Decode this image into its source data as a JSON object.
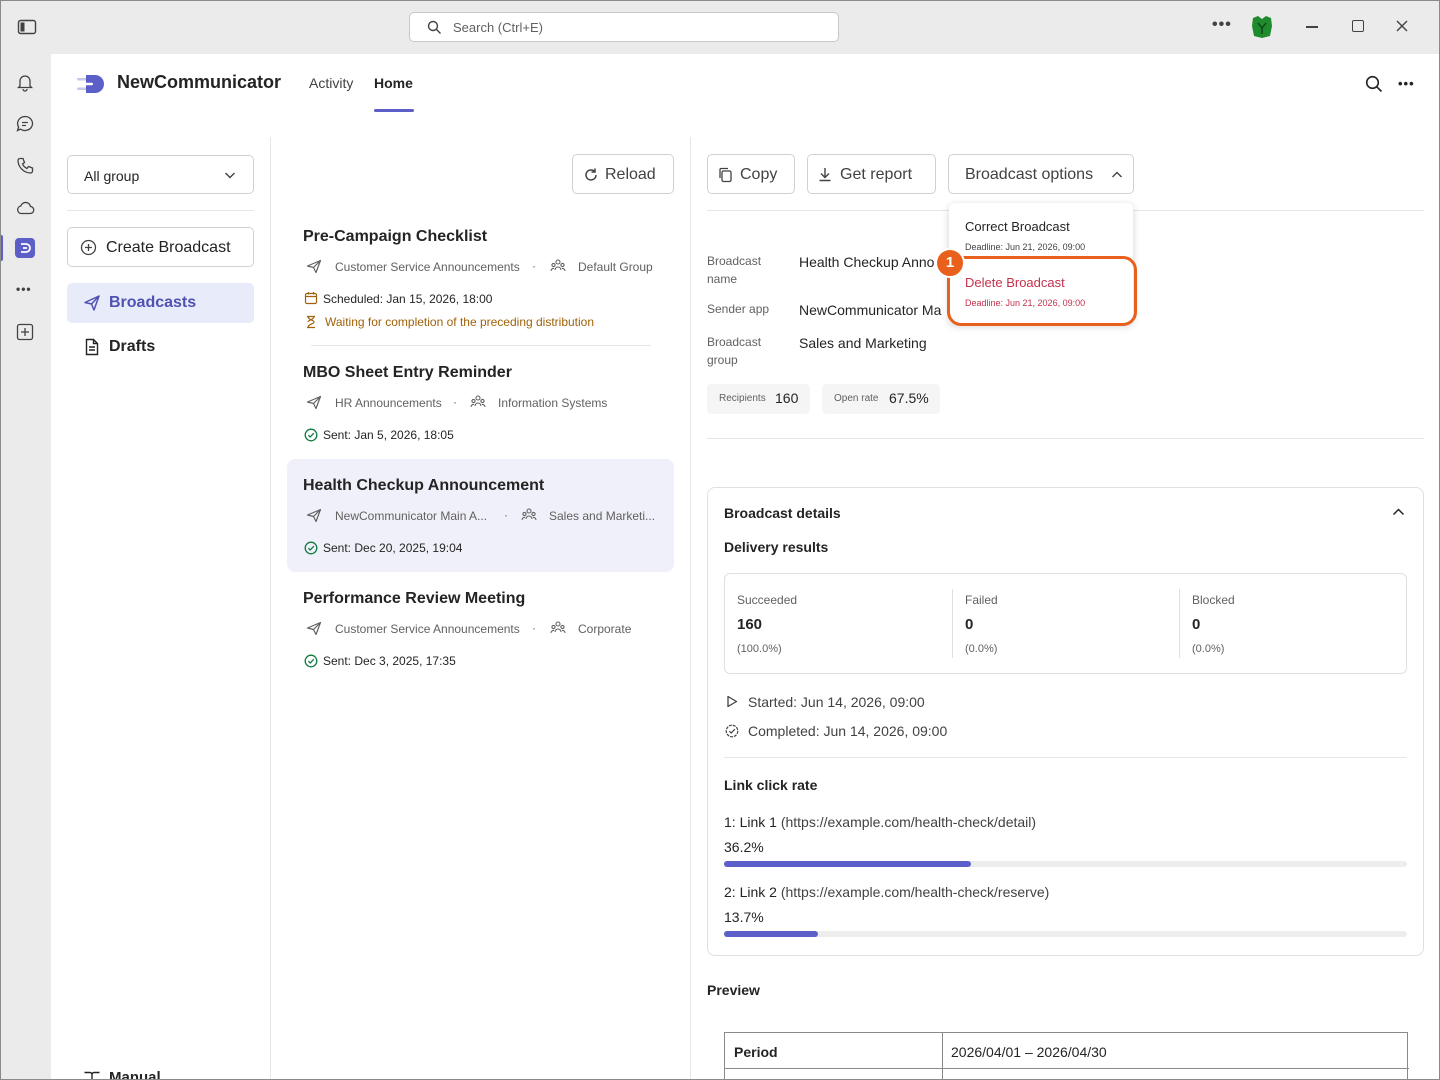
{
  "titlebar": {
    "search_placeholder": "Search (Ctrl+E)"
  },
  "app": {
    "name": "NewCommunicator",
    "tabs": [
      {
        "label": "Activity",
        "active": false
      },
      {
        "label": "Home",
        "active": true
      }
    ]
  },
  "sidebar": {
    "group_select": "All group",
    "create_label": "Create Broadcast",
    "items": [
      {
        "label": "Broadcasts",
        "active": true
      },
      {
        "label": "Drafts",
        "active": false
      }
    ],
    "manual_label": "Manual"
  },
  "list": {
    "reload_label": "Reload",
    "items": [
      {
        "title": "Pre-Campaign Checklist",
        "sender": "Customer Service Announcements",
        "group": "Default Group",
        "status": "Scheduled: Jan 15, 2026, 18:00",
        "warning": "Waiting for completion of the preceding distribution"
      },
      {
        "title": "MBO Sheet Entry Reminder",
        "sender": "HR Announcements",
        "group": "Information Systems",
        "status": "Sent: Jan 5, 2026, 18:05"
      },
      {
        "title": "Health Checkup Announcement",
        "sender": "NewCommunicator Main A...",
        "group": "Sales and Marketi...",
        "status": "Sent: Dec 20, 2025, 19:04",
        "selected": true
      },
      {
        "title": "Performance Review Meeting",
        "sender": "Customer Service Announcements",
        "group": "Corporate",
        "status": "Sent: Dec 3, 2025, 17:35"
      }
    ]
  },
  "toolbar": {
    "copy_label": "Copy",
    "report_label": "Get report",
    "options_label": "Broadcast options"
  },
  "options_menu": {
    "items": [
      {
        "label": "Correct Broadcast",
        "sub": "Deadline: Jun 21, 2026, 09:00",
        "danger": false
      },
      {
        "label": "Delete Broadcast",
        "sub": "Deadline: Jun 21, 2026, 09:00",
        "danger": true
      }
    ],
    "callout_number": "1"
  },
  "detail": {
    "name_label_1": "Broadcast",
    "name_label_2": "name",
    "name_value": "Health Checkup Anno",
    "sender_label": "Sender app",
    "sender_value": "NewCommunicator Ma",
    "group_label_1": "Broadcast",
    "group_label_2": "group",
    "group_value": "Sales and Marketing",
    "recipients_label": "Recipients",
    "recipients_value": "160",
    "openrate_label": "Open rate",
    "openrate_value": "67.5%"
  },
  "details_panel": {
    "title": "Broadcast details",
    "delivery_title": "Delivery results",
    "results": [
      {
        "label": "Succeeded",
        "count": "160",
        "pct": "(100.0%)"
      },
      {
        "label": "Failed",
        "count": "0",
        "pct": "(0.0%)"
      },
      {
        "label": "Blocked",
        "count": "0",
        "pct": "(0.0%)"
      }
    ],
    "started_label": "Started:",
    "started_value": "Jun 14, 2026, 09:00",
    "completed_label": "Completed:",
    "completed_value": "Jun 14, 2026, 09:00",
    "link_title": "Link click rate",
    "links": [
      {
        "label": "1: Link 1",
        "url": "(https://example.com/health-check/detail)",
        "rate_text": "36.2%",
        "rate": 0.362
      },
      {
        "label": "2: Link 2",
        "url": "(https://example.com/health-check/reserve)",
        "rate_text": "13.7%",
        "rate": 0.137
      }
    ]
  },
  "preview": {
    "title": "Preview",
    "period_label": "Period",
    "period_value": "2026/04/01 – 2026/04/30"
  },
  "colors": {
    "accent": "#5b5fc7",
    "danger": "#c4314b",
    "callout": "#e8601c",
    "warning": "#a0620a",
    "success": "#107c41"
  }
}
